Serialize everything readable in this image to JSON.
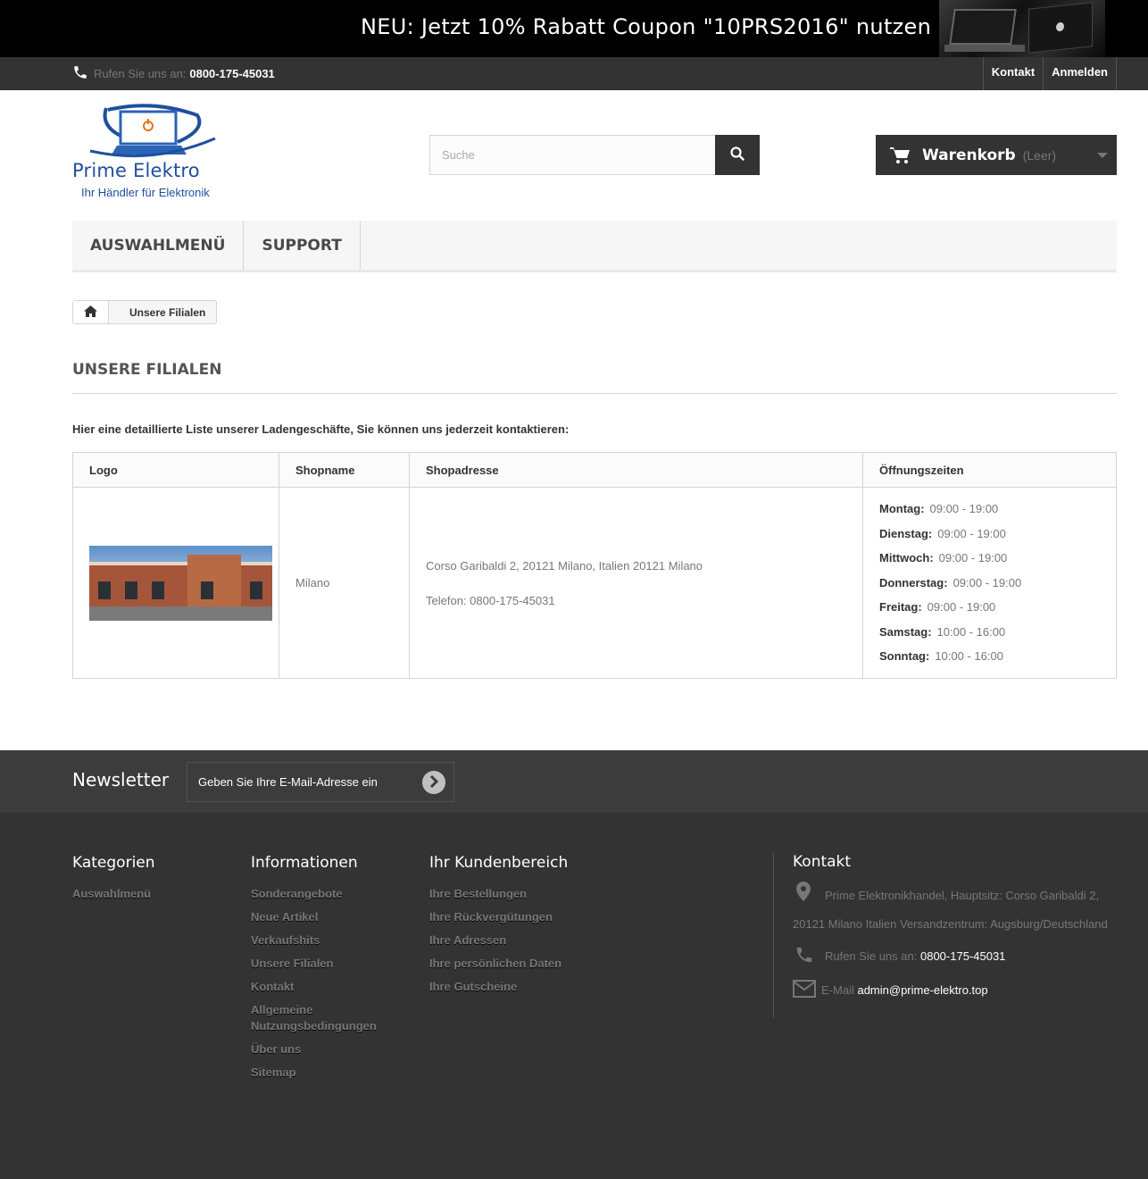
{
  "promo": {
    "text": "NEU: Jetzt 10% Rabatt Coupon \"10PRS2016\" nutzen"
  },
  "topnav": {
    "phone_label": "Rufen Sie uns an:",
    "phone_number": "0800-175-45031",
    "links": [
      "Kontakt",
      "Anmelden"
    ]
  },
  "logo": {
    "name": "Prime Elektro",
    "tagline": "Ihr Händler für Elektronik"
  },
  "search": {
    "placeholder": "Suche"
  },
  "cart": {
    "title": "Warenkorb",
    "status": "(Leer)"
  },
  "menu": {
    "items": [
      "AUSWAHLMENÜ",
      "SUPPORT"
    ]
  },
  "breadcrumb": {
    "current": "Unsere Filialen"
  },
  "page": {
    "title": "UNSERE FILIALEN",
    "intro": "Hier eine detaillierte Liste unserer Ladengeschäfte, Sie können uns jederzeit kontaktieren:"
  },
  "table": {
    "headers": [
      "Logo",
      "Shopname",
      "Shopadresse",
      "Öffnungszeiten"
    ],
    "store": {
      "name": "Milano",
      "address": "Corso Garibaldi 2, 20121 Milano, Italien 20121 Milano",
      "phone": "Telefon: 0800-175-45031",
      "hours": [
        {
          "day": "Montag:",
          "time": "09:00 - 19:00"
        },
        {
          "day": "Dienstag:",
          "time": "09:00 - 19:00"
        },
        {
          "day": "Mittwoch:",
          "time": "09:00 - 19:00"
        },
        {
          "day": "Donnerstag:",
          "time": "09:00 - 19:00"
        },
        {
          "day": "Freitag:",
          "time": "09:00 - 19:00"
        },
        {
          "day": "Samstag:",
          "time": "10:00 - 16:00"
        },
        {
          "day": "Sonntag:",
          "time": "10:00 - 16:00"
        }
      ]
    }
  },
  "newsletter": {
    "title": "Newsletter",
    "placeholder": "Geben Sie Ihre E-Mail-Adresse ein"
  },
  "footer": {
    "categories": {
      "title": "Kategorien",
      "items": [
        "Auswahlmenü"
      ]
    },
    "information": {
      "title": "Informationen",
      "items": [
        "Sonderangebote",
        "Neue Artikel",
        "Verkaufshits",
        "Unsere Filialen",
        "Kontakt",
        "Allgemeine Nutzungsbedingungen",
        "Über uns",
        "Sitemap"
      ]
    },
    "account": {
      "title": "Ihr Kundenbereich",
      "items": [
        "Ihre Bestellungen",
        "Ihre Rückvergütungen",
        "Ihre Adressen",
        "Ihre persönlichen Daten",
        "Ihre Gutscheine"
      ]
    },
    "contact": {
      "title": "Kontakt",
      "address_line1": "Prime Elektronikhandel, Hauptsitz: Corso Garibaldi 2,",
      "address_line2": "20121 Milano Italien Versandzentrum: Augsburg/Deutschland",
      "phone_label": "Rufen Sie uns an:",
      "phone": "0800-175-45031",
      "email_label": "E-Mail",
      "email": "admin@prime-elektro.top"
    }
  }
}
